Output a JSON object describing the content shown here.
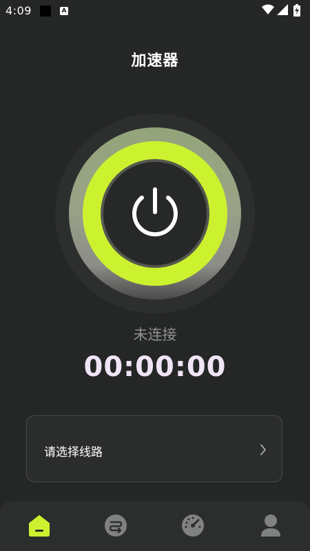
{
  "status_bar": {
    "time": "4:09",
    "a_badge": "A"
  },
  "header": {
    "title": "加速器"
  },
  "power": {
    "icon": "power-icon",
    "accent": "#ccf22f"
  },
  "connection": {
    "status": "未连接",
    "timer": "00:00:00"
  },
  "route": {
    "label": "请选择线路",
    "icon": "chevron-right-icon"
  },
  "nav": {
    "items": [
      {
        "icon": "home-icon",
        "active": true
      },
      {
        "icon": "route-icon",
        "active": false
      },
      {
        "icon": "speedometer-icon",
        "active": false
      },
      {
        "icon": "user-icon",
        "active": false
      }
    ]
  },
  "colors": {
    "background": "#252726",
    "accent": "#ccf22f",
    "timer": "#f0e4f7"
  }
}
